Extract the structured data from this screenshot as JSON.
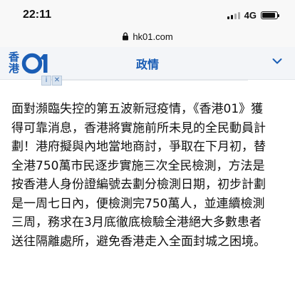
{
  "status_bar": {
    "time": "22:11",
    "network": "4G",
    "battery_level": 0.92
  },
  "browser": {
    "url": "hk01.com"
  },
  "header": {
    "logo_text": "香港",
    "title": "政情"
  },
  "ad": {
    "info_icon": "i",
    "close_icon": "✕"
  },
  "article": {
    "lines": [
      "面對瀕臨失控的第五波新冠疫情，《香港01》獲",
      "得可靠消息，香港將實施前所未見的全民動員計",
      "劃！港府擬與內地當地商討，爭取在下月初，替",
      "全港750萬市民逐步實施三次全民檢測，方法是",
      "按香港人身份證編號去劃分檢測日期，初步計劃",
      "是一周七日內，便檢測完750萬人，並連續檢測",
      "三周，務求在3月底徹底檢驗全港絕大多數患者",
      "送往隔離處所，避免香港走入全面封城之困境。"
    ]
  },
  "colors": {
    "brand": "#1a5db5",
    "header_bg": "#f3f5f8",
    "text": "#111111"
  }
}
